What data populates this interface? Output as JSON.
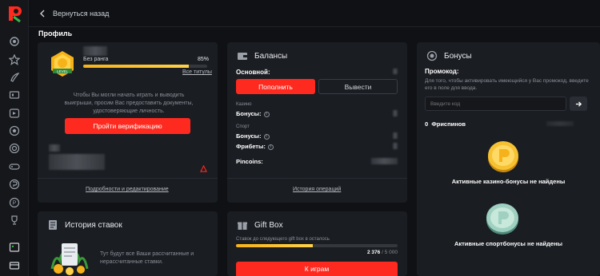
{
  "topbar": {
    "back_label": "Вернуться назад"
  },
  "page": {
    "title": "Профиль"
  },
  "profile": {
    "badge_label": "LEVEL",
    "rank": "Без ранга",
    "progress_percent_label": "85%",
    "progress": 0.85,
    "all_titles": "Все титулы",
    "verify_text": "Чтобы Вы могли начать играть и выводить выигрыши, просим Вас предоставить документы, удостоверяющие личность.",
    "verify_button": "Пройти верификацию",
    "details_link": "Подробности и редактирование"
  },
  "balances": {
    "title": "Балансы",
    "main_label": "Основной:",
    "deposit_button": "Пополнить",
    "withdraw_button": "Вывести",
    "casino_label": "Казино",
    "casino_bonuses": "Бонусы:",
    "sport_label": "Спорт",
    "sport_bonuses": "Бонусы:",
    "freebets": "Фрибеты:",
    "pincoins": "Pincoins:",
    "history_link": "История операций"
  },
  "bonuses": {
    "title": "Бонусы",
    "promo_label": "Промокод:",
    "promo_hint": "Для того, чтобы активировать имеющийся у Вас промокод, введите его в поле для ввода.",
    "promo_placeholder": "Введите код",
    "freespins_count": "0",
    "freespins_label": "Фриспинов",
    "casino_empty": "Активные казино-бонусы не найдены",
    "sport_empty": "Активные спортбонусы не найдены"
  },
  "bet_history": {
    "title": "История ставок",
    "text": "Тут будут все Ваши рассчитанные и нерассчитанные ставки."
  },
  "giftbox": {
    "title": "Gift Box",
    "caption": "Ставок до следующего gift box в осталось",
    "progress_label": "2 376",
    "progress_total": "/ 5 000",
    "progress": 0.475,
    "button": "К играм"
  },
  "colors": {
    "accent": "#ff2a1f",
    "gold": "#f6b21a",
    "card": "#1a1d22",
    "bg": "#0f1114"
  },
  "rail_icons": [
    "settings-icon",
    "star-icon",
    "rocket-icon",
    "casino-icon",
    "live-icon",
    "ball-icon",
    "esports-icon",
    "target-icon",
    "gamepad-icon",
    "bonus-icon",
    "pincoin-icon",
    "tournament-icon",
    "promo-icon",
    "wallet-icon"
  ]
}
